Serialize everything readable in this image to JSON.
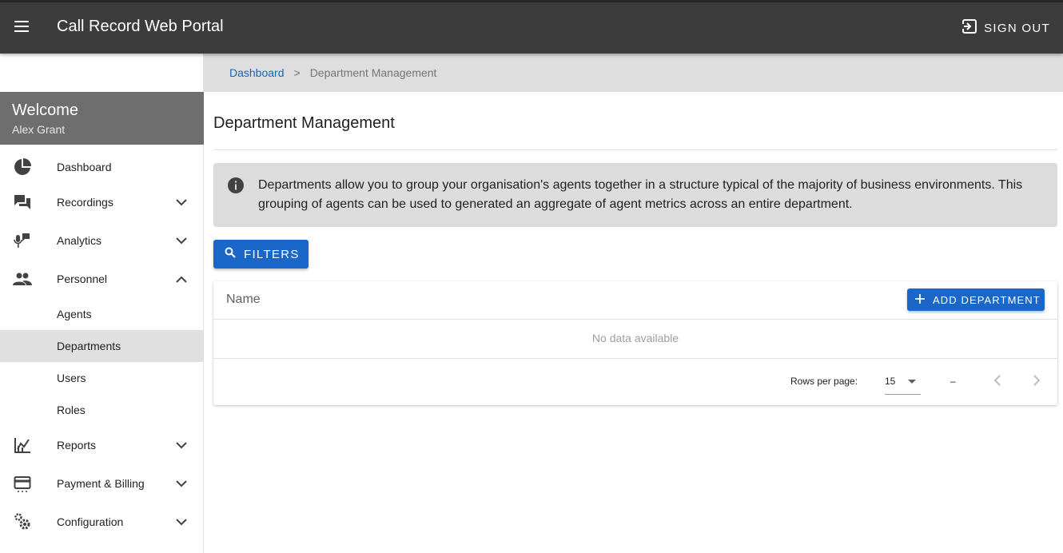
{
  "header": {
    "app_title": "Call Record Web Portal",
    "sign_out_label": "SIGN OUT"
  },
  "sidebar": {
    "welcome_title": "Welcome",
    "user_name": "Alex Grant",
    "items": [
      {
        "label": "Dashboard",
        "icon": "pie-chart-icon"
      },
      {
        "label": "Recordings",
        "icon": "chat-icon",
        "expanded": false
      },
      {
        "label": "Analytics",
        "icon": "voice-analytics-icon",
        "expanded": false
      },
      {
        "label": "Personnel",
        "icon": "people-icon",
        "expanded": true
      },
      {
        "label": "Reports",
        "icon": "reports-chart-icon",
        "expanded": false
      },
      {
        "label": "Payment & Billing",
        "icon": "credit-card-icon",
        "expanded": false
      },
      {
        "label": "Configuration",
        "icon": "gears-icon",
        "expanded": false
      }
    ],
    "personnel_sub": [
      {
        "label": "Agents",
        "active": false
      },
      {
        "label": "Departments",
        "active": true
      },
      {
        "label": "Users",
        "active": false
      },
      {
        "label": "Roles",
        "active": false
      }
    ]
  },
  "breadcrumb": {
    "home": "Dashboard",
    "separator": ">",
    "current": "Department Management"
  },
  "main": {
    "page_title": "Department Management",
    "info_text": "Departments allow you to group your organisation's agents together in a structure typical of the majority of business environments. This grouping of agents can be used to generated an aggregate of agent metrics across an entire department.",
    "filters_label": "FILTERS",
    "table": {
      "columns": [
        "Name"
      ],
      "add_label": "ADD DEPARTMENT",
      "empty_text": "No data available",
      "rows_per_page_label": "Rows per page:",
      "rows_per_page_value": "15",
      "page_range": "–"
    }
  },
  "colors": {
    "topbar": "#3c3c3c",
    "accent": "#1a66c9",
    "welcome": "#6e6e6e",
    "breadcrumb_bg": "#dedede",
    "info_bg": "#dcdcdc"
  }
}
